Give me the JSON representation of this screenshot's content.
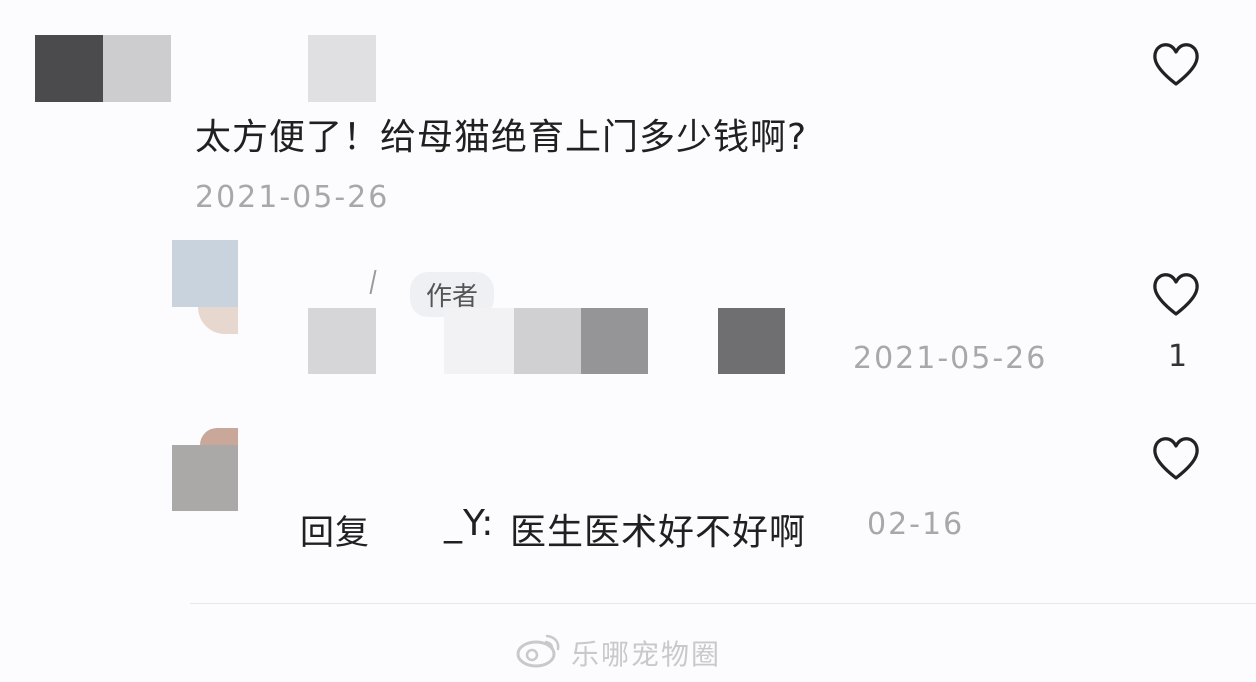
{
  "comment1": {
    "text": "太方便了！给母猫绝育上门多少钱啊?",
    "date": "2021-05-26"
  },
  "reply1": {
    "author_badge": "作者",
    "date": "2021-05-26",
    "like_count": "1"
  },
  "reply2": {
    "prefix": "回复",
    "target_fragment": "_Y:",
    "text": "医生医术好不好啊",
    "date": "02-16"
  },
  "watermark": {
    "text": "乐哪宠物圈"
  },
  "icons": {
    "like": "heart-outline-icon",
    "watermark": "weibo-logo-icon"
  },
  "colors": {
    "background": "#fcfcfe",
    "date_text": "#a8a8aa",
    "badge_bg": "#eef0f4"
  }
}
